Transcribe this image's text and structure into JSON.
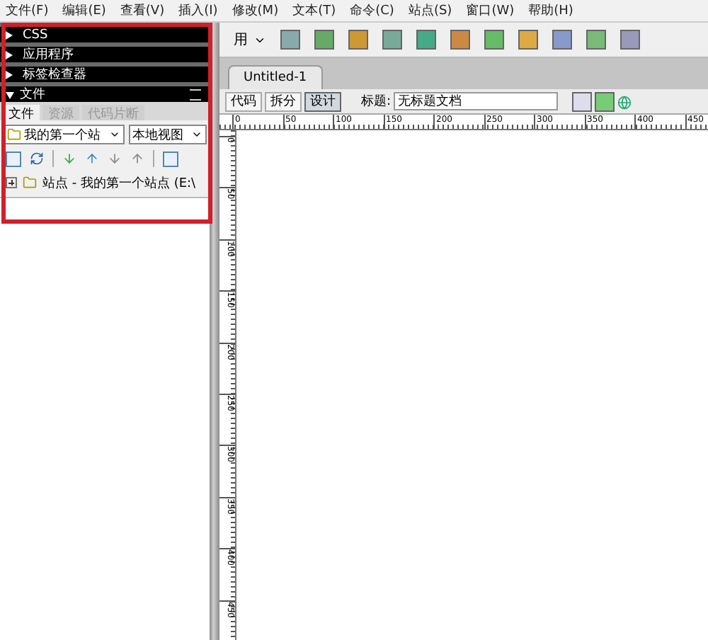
{
  "menu": [
    "文件(F)",
    "编辑(E)",
    "查看(V)",
    "插入(I)",
    "修改(M)",
    "文本(T)",
    "命令(C)",
    "站点(S)",
    "窗口(W)",
    "帮助(H)"
  ],
  "panel_groups": [
    {
      "label": "CSS",
      "expanded": false
    },
    {
      "label": "应用程序",
      "expanded": false
    },
    {
      "label": "标签检查器",
      "expanded": false
    },
    {
      "label": "文件",
      "expanded": true
    }
  ],
  "panel_tabs": [
    {
      "label": "文件",
      "selected": true
    },
    {
      "label": "资源",
      "selected": false
    },
    {
      "label": "代码片断",
      "selected": false
    }
  ],
  "site_select": {
    "value": "我的第一个站"
  },
  "view_select": {
    "value": "本地视图"
  },
  "file_tree": [
    {
      "label": "站点 - 我的第一个站点 (E:\\",
      "expanded": false
    }
  ],
  "insert_toolbar": {
    "category": "用"
  },
  "document_tab": {
    "title": "Untitled-1"
  },
  "view_buttons": [
    {
      "label": "代码",
      "selected": false
    },
    {
      "label": "拆分",
      "selected": false
    },
    {
      "label": "设计",
      "selected": true
    }
  ],
  "title_field": {
    "label": "标题:",
    "value": "无标题文档"
  },
  "ruler": {
    "horizontal": [
      "0",
      "50",
      "100",
      "150",
      "200",
      "250",
      "300",
      "350",
      "400",
      "450"
    ],
    "vertical": [
      "0",
      "50",
      "100",
      "150",
      "200",
      "250",
      "300",
      "350",
      "400",
      "450"
    ]
  }
}
